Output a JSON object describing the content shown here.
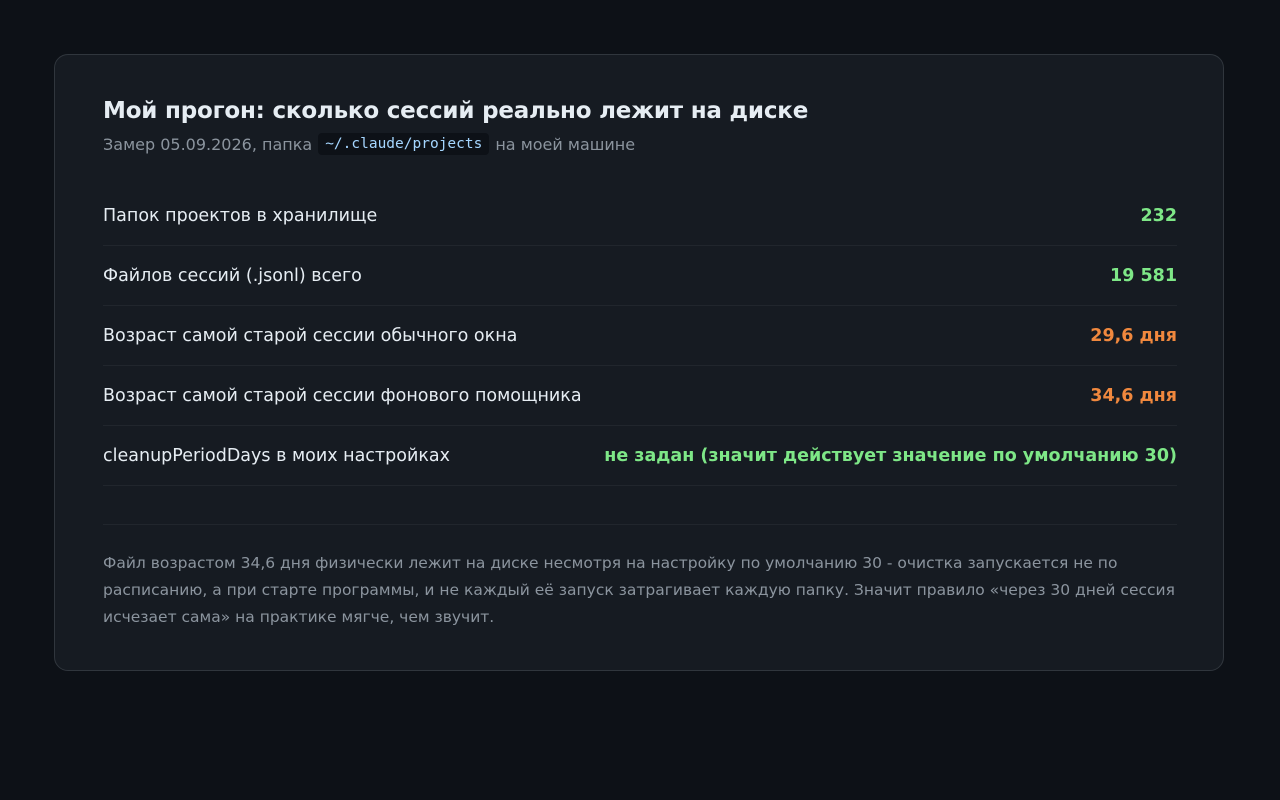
{
  "card": {
    "title": "Мой прогон: сколько сессий реально лежит на диске",
    "subtitle_prefix": "Замер 05.09.2026, папка",
    "subtitle_path": "~/.claude/projects",
    "subtitle_suffix": "на моей машине"
  },
  "stats": [
    {
      "label": "Папок проектов в хранилище",
      "value": "232",
      "color": "#7ee787"
    },
    {
      "label": "Файлов сессий (.jsonl) всего",
      "value": "19 581",
      "color": "#7ee787"
    },
    {
      "label": "Возраст самой старой сессии обычного окна",
      "value": "29,6 дня",
      "color": "#f0883e"
    },
    {
      "label": "Возраст самой старой сессии фонового помощника",
      "value": "34,6 дня",
      "color": "#f0883e"
    },
    {
      "label": "cleanupPeriodDays в моих настройках",
      "value": "не задан (значит действует значение по умолчанию 30)",
      "color": "#7ee787"
    }
  ],
  "note": "Файл возрастом 34,6 дня физически лежит на диске несмотря на настройку по умолчанию 30 - очистка запускается не по расписанию, а при старте программы, и не каждый её запуск затрагивает каждую папку. Значит правило «через 30 дней сессия исчезает сама» на практике мягче, чем звучит."
}
